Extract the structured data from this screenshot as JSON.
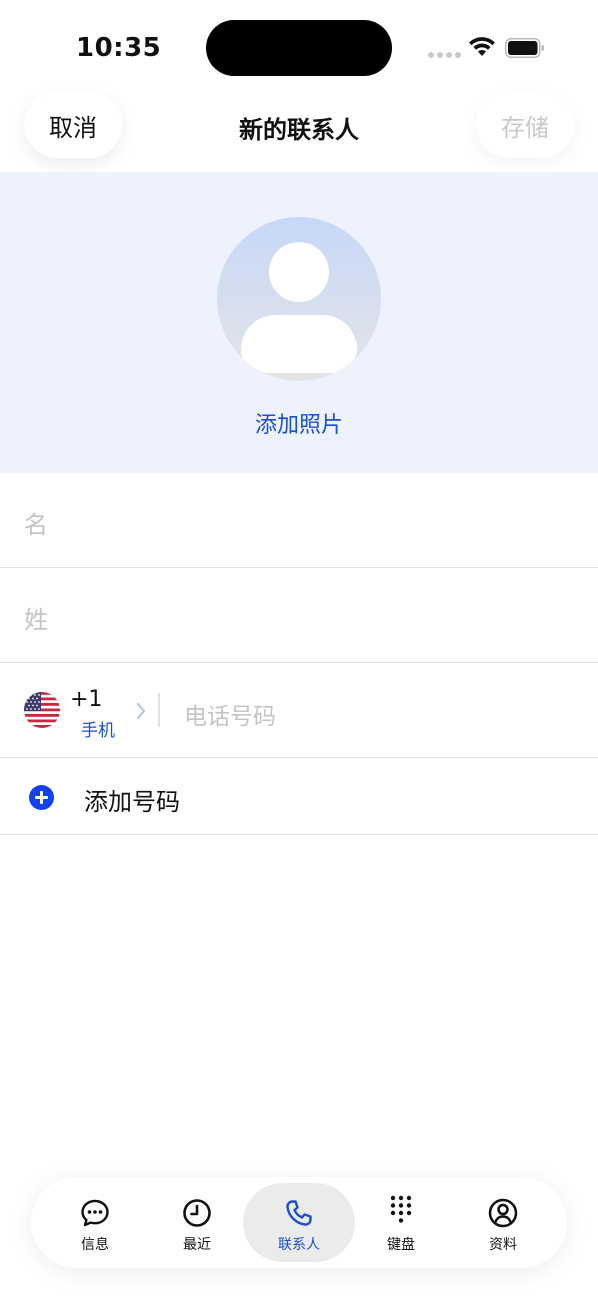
{
  "status_bar": {
    "time": "10:35"
  },
  "nav": {
    "cancel_label": "取消",
    "title": "新的联系人",
    "save_label": "存储"
  },
  "photo": {
    "add_photo_label": "添加照片"
  },
  "form": {
    "first_name_placeholder": "名",
    "last_name_placeholder": "姓",
    "phone": {
      "country_code": "+1",
      "type_label": "手机",
      "placeholder": "电话号码",
      "flag_icon": "us-flag-icon"
    },
    "add_number_label": "添加号码"
  },
  "tabbar": {
    "items": [
      {
        "label": "信息",
        "icon": "message-bubble-icon",
        "active": false
      },
      {
        "label": "最近",
        "icon": "clock-icon",
        "active": false
      },
      {
        "label": "联系人",
        "icon": "phone-icon",
        "active": true
      },
      {
        "label": "键盘",
        "icon": "keypad-icon",
        "active": false
      },
      {
        "label": "资料",
        "icon": "profile-icon",
        "active": false
      }
    ]
  },
  "colors": {
    "accent": "#1a4fd6",
    "header_bg": "#edf2fc",
    "placeholder": "#c4c4c8",
    "add_button": "#1441f0"
  }
}
